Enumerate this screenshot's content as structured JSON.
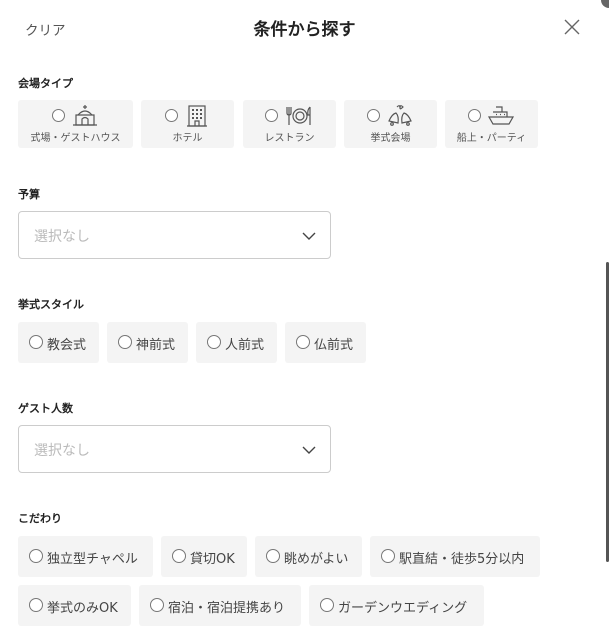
{
  "header": {
    "clear_label": "クリア",
    "title": "条件から探す"
  },
  "venue_type": {
    "label": "会場タイプ",
    "options": [
      {
        "label": "式場・ゲストハウス",
        "icon": "chapel-icon"
      },
      {
        "label": "ホテル",
        "icon": "hotel-building-icon"
      },
      {
        "label": "レストラン",
        "icon": "restaurant-icon"
      },
      {
        "label": "挙式会場",
        "icon": "wedding-bells-icon"
      },
      {
        "label": "船上・パーティ",
        "icon": "ship-icon"
      }
    ]
  },
  "budget": {
    "label": "予算",
    "value": "選択なし"
  },
  "ceremony_style": {
    "label": "挙式スタイル",
    "options": [
      "教会式",
      "神前式",
      "人前式",
      "仏前式"
    ]
  },
  "guest_count": {
    "label": "ゲスト人数",
    "value": "選択なし"
  },
  "preferences": {
    "label": "こだわり",
    "options": [
      "独立型チャペル",
      "貸切OK",
      "眺めがよい",
      "駅直結・徒歩5分以内",
      "挙式のみOK",
      "宿泊・宿泊提携あり",
      "ガーデンウエディング"
    ]
  },
  "colors": {
    "chip_bg": "#f4f4f4",
    "placeholder": "#bbbbbb",
    "border": "#cccccc"
  }
}
